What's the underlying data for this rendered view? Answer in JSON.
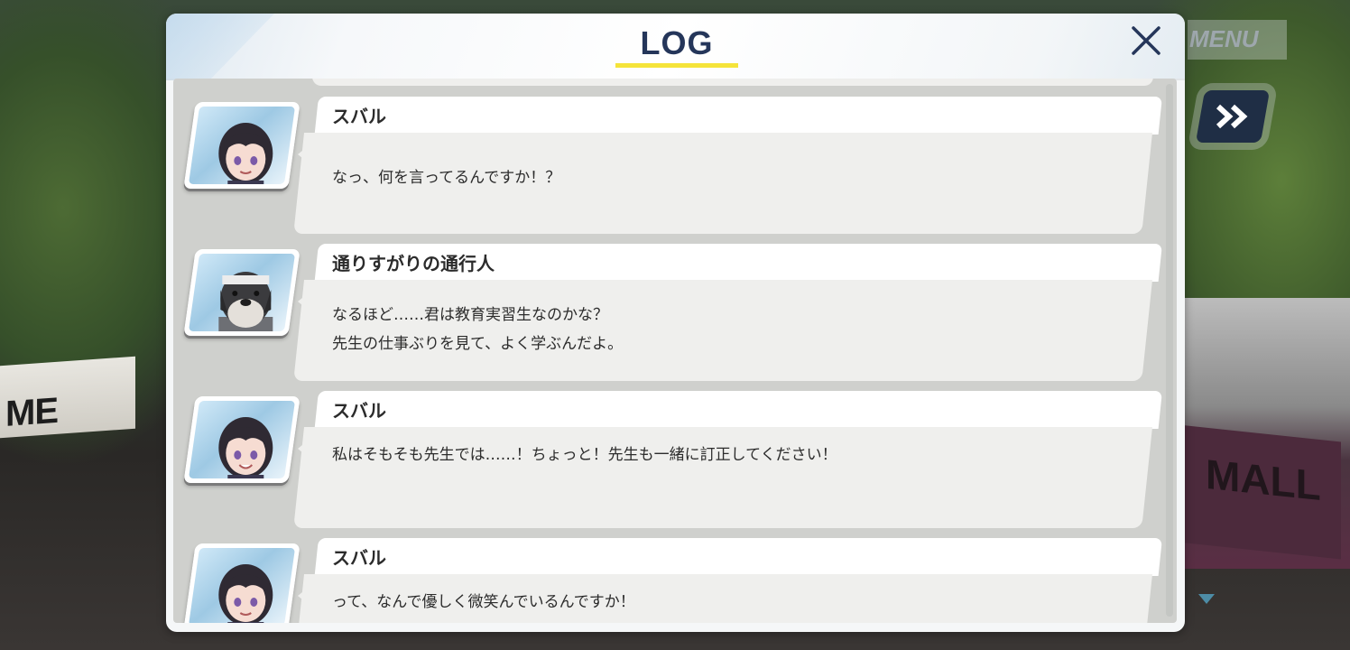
{
  "log": {
    "title": "LOG",
    "close_icon": "close-icon",
    "entries": [
      {
        "speaker": "スバル",
        "avatar": "subaru-portrait",
        "lines": [
          "なっ、何を言ってるんですか！？"
        ]
      },
      {
        "speaker": "通りすがりの通行人",
        "avatar": "schnauzer-portrait",
        "lines": [
          "なるほど……君は教育実習生なのかな？",
          "先生の仕事ぶりを見て、よく学ぶんだよ。"
        ]
      },
      {
        "speaker": "スバル",
        "avatar": "subaru-portrait",
        "lines": [
          "私はそもそも先生では……！ちょっと！先生も一緒に訂正してください！"
        ]
      },
      {
        "speaker": "スバル",
        "avatar": "subaru-portrait",
        "lines": [
          "って、なんで優しく微笑んでいるんですか！"
        ]
      }
    ]
  },
  "hud": {
    "menu_label": "MENU",
    "skip_icon": "fast-forward-icon",
    "next_icon": "next-arrow-icon"
  },
  "background": {
    "sign_left_text": "ME",
    "mall_text": "MALL"
  },
  "colors": {
    "title": "#25365a",
    "title_underline": "#f5e43a",
    "skip_button": "#1f2e45"
  }
}
